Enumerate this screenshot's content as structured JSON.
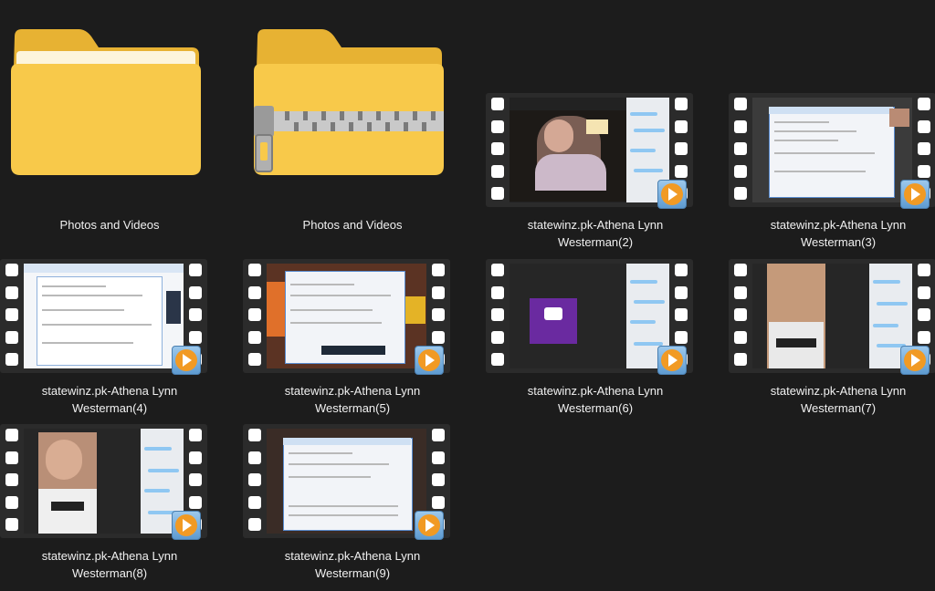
{
  "items": [
    {
      "line1": "Photos and Videos",
      "line2": "",
      "type": "folder",
      "icon": "folder-icon"
    },
    {
      "line1": "Photos and Videos",
      "line2": "",
      "type": "zip",
      "icon": "zip-folder-icon"
    },
    {
      "line1": "statewinz.pk-Athena Lynn",
      "line2": "Westerman(2)",
      "type": "video",
      "icon": "video-file-icon"
    },
    {
      "line1": "statewinz.pk-Athena Lynn",
      "line2": "Westerman(3)",
      "type": "video",
      "icon": "video-file-icon"
    },
    {
      "line1": "statewinz.pk-Athena Lynn",
      "line2": "Westerman(4)",
      "type": "video",
      "icon": "video-file-icon"
    },
    {
      "line1": "statewinz.pk-Athena Lynn",
      "line2": "Westerman(5)",
      "type": "video",
      "icon": "video-file-icon"
    },
    {
      "line1": "statewinz.pk-Athena Lynn",
      "line2": "Westerman(6)",
      "type": "video",
      "icon": "video-file-icon"
    },
    {
      "line1": "statewinz.pk-Athena Lynn",
      "line2": "Westerman(7)",
      "type": "video",
      "icon": "video-file-icon"
    },
    {
      "line1": "statewinz.pk-Athena Lynn",
      "line2": "Westerman(8)",
      "type": "video",
      "icon": "video-file-icon"
    },
    {
      "line1": "statewinz.pk-Athena Lynn",
      "line2": "Westerman(9)",
      "type": "video",
      "icon": "video-file-icon"
    }
  ],
  "colors": {
    "background": "#1c1c1c",
    "folder": "#f8c94a",
    "play_orange": "#f19a24",
    "chat_bubble": "#8fc7f2"
  }
}
